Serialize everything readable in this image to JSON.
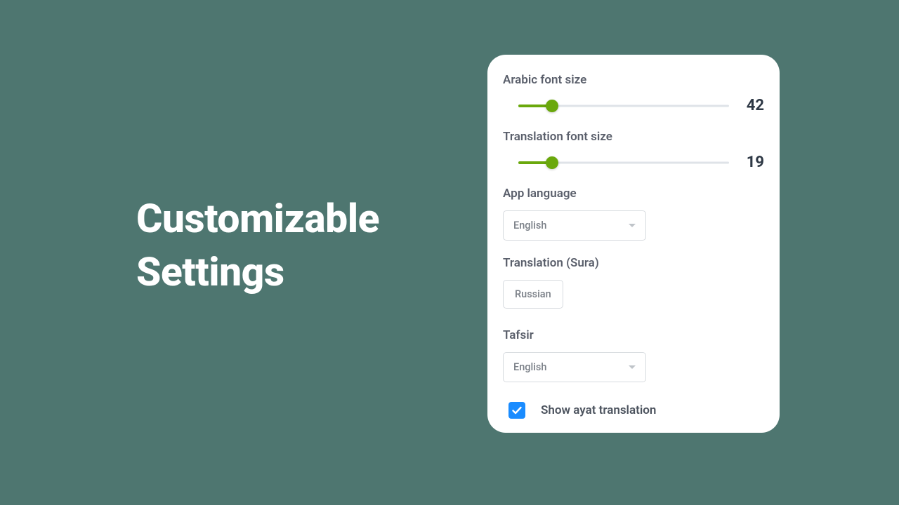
{
  "heading": {
    "line1": "Customizable",
    "line2": "Settings"
  },
  "settings": {
    "arabic_font": {
      "label": "Arabic font size",
      "value": "42",
      "percent": 16
    },
    "translation_font": {
      "label": "Translation font size",
      "value": "19",
      "percent": 16
    },
    "app_language": {
      "label": "App language",
      "selected": "English"
    },
    "translation_sura": {
      "label": "Translation (Sura)",
      "selected": "Russian"
    },
    "tafsir": {
      "label": "Tafsir",
      "selected": "English"
    },
    "show_ayat": {
      "label": "Show ayat translation",
      "checked": true
    }
  },
  "colors": {
    "background": "#4e7670",
    "slider_active": "#6aa80c",
    "checkbox_bg": "#1a8cff"
  }
}
